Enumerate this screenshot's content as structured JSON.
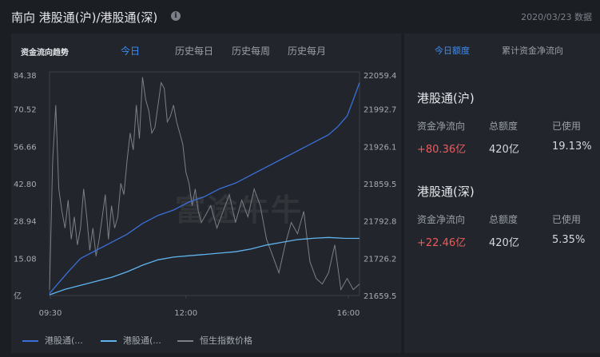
{
  "header": {
    "title": "南向 港股通(沪)/港股通(深)",
    "date_note": "2020/03/23 数据"
  },
  "chart_panel": {
    "title": "资金流向趋势",
    "tabs": [
      "今日",
      "历史每日",
      "历史每周",
      "历史每月"
    ],
    "active_tab": 0,
    "watermark": "富途牛牛",
    "legend": [
      {
        "label": "港股通(...",
        "color": "#3b6fd8"
      },
      {
        "label": "港股通(...",
        "color": "#5fb4ee"
      },
      {
        "label": "恒生指数价格",
        "color": "#7b7f86"
      }
    ]
  },
  "chart_data": {
    "type": "line",
    "x_ticks": [
      "09:30",
      "12:00",
      "16:00"
    ],
    "y_left_ticks": [
      "84.38",
      "70.52",
      "56.66",
      "42.80",
      "28.94",
      "15.08",
      "亿"
    ],
    "y_left_range": [
      1.22,
      84.38
    ],
    "y_right_ticks": [
      "22059.4",
      "21992.7",
      "21926.1",
      "21859.5",
      "21792.8",
      "21726.2",
      "21659.5"
    ],
    "y_right_range": [
      21659.5,
      22059.4
    ],
    "series": [
      {
        "name": "港股通(...",
        "color": "#3b6fd8",
        "axis": "left",
        "x": [
          0,
          0.03,
          0.06,
          0.1,
          0.15,
          0.2,
          0.25,
          0.3,
          0.35,
          0.4,
          0.45,
          0.5,
          0.55,
          0.6,
          0.65,
          0.7,
          0.75,
          0.8,
          0.85,
          0.9,
          0.93,
          0.96,
          0.98,
          1.0
        ],
        "values": [
          2,
          6,
          10,
          15,
          18,
          21,
          24,
          28,
          31,
          33,
          36,
          38,
          41,
          43,
          46,
          49,
          52,
          55,
          58,
          61,
          64,
          68,
          74,
          80.36
        ]
      },
      {
        "name": "港股通(...",
        "color": "#5fb4ee",
        "axis": "left",
        "x": [
          0,
          0.05,
          0.1,
          0.15,
          0.2,
          0.25,
          0.3,
          0.35,
          0.4,
          0.45,
          0.5,
          0.55,
          0.6,
          0.65,
          0.7,
          0.75,
          0.8,
          0.85,
          0.9,
          0.95,
          1.0
        ],
        "values": [
          1.5,
          3.5,
          5,
          6.5,
          8,
          10,
          12.5,
          14.5,
          15.5,
          16,
          16.5,
          17,
          17.5,
          18.5,
          20,
          21,
          22,
          22.5,
          22.8,
          22.5,
          22.46
        ]
      },
      {
        "name": "恒生指数价格",
        "color": "#7b7f86",
        "axis": "right",
        "x": [
          0,
          0.01,
          0.02,
          0.03,
          0.04,
          0.05,
          0.06,
          0.07,
          0.08,
          0.09,
          0.1,
          0.11,
          0.12,
          0.13,
          0.14,
          0.15,
          0.16,
          0.17,
          0.18,
          0.19,
          0.2,
          0.21,
          0.22,
          0.23,
          0.24,
          0.25,
          0.26,
          0.27,
          0.28,
          0.29,
          0.3,
          0.31,
          0.32,
          0.33,
          0.34,
          0.35,
          0.36,
          0.37,
          0.38,
          0.39,
          0.4,
          0.41,
          0.42,
          0.43,
          0.44,
          0.45,
          0.46,
          0.47,
          0.48,
          0.49,
          0.5,
          0.52,
          0.54,
          0.56,
          0.58,
          0.6,
          0.62,
          0.64,
          0.66,
          0.68,
          0.7,
          0.72,
          0.74,
          0.76,
          0.78,
          0.8,
          0.82,
          0.84,
          0.86,
          0.88,
          0.9,
          0.92,
          0.94,
          0.96,
          0.98,
          1.0
        ],
        "values": [
          21670,
          21900,
          22000,
          21850,
          21810,
          21780,
          21830,
          21760,
          21800,
          21750,
          21780,
          21850,
          21800,
          21740,
          21780,
          21730,
          21760,
          21800,
          21840,
          21760,
          21820,
          21780,
          21800,
          21860,
          21840,
          21900,
          21950,
          21920,
          22000,
          21940,
          22050,
          22010,
          21990,
          21950,
          21960,
          22000,
          22040,
          22030,
          21970,
          21980,
          22000,
          21970,
          21950,
          21930,
          21880,
          21860,
          21820,
          21850,
          21810,
          21790,
          21800,
          21820,
          21780,
          21810,
          21840,
          21790,
          21830,
          21800,
          21850,
          21820,
          21760,
          21730,
          21700,
          21750,
          21790,
          21770,
          21810,
          21720,
          21690,
          21680,
          21700,
          21750,
          21670,
          21690,
          21670,
          21680
        ]
      }
    ]
  },
  "side_panel": {
    "tabs": [
      "今日额度",
      "累计资金净流向"
    ],
    "active_tab": 0,
    "col_labels": [
      "资金净流向",
      "总额度",
      "已使用"
    ],
    "sections": [
      {
        "title": "港股通(沪)",
        "flow": "+80.36亿",
        "quota": "420亿",
        "used": "19.13%"
      },
      {
        "title": "港股通(深)",
        "flow": "+22.46亿",
        "quota": "420亿",
        "used": "5.35%"
      }
    ]
  }
}
